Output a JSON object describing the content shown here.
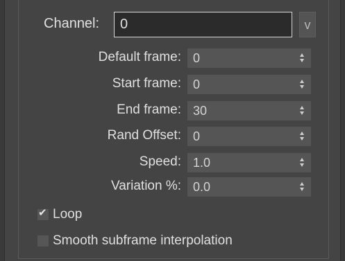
{
  "channel": {
    "label": "Channel:",
    "value": "0",
    "button_label": "v"
  },
  "fields": [
    {
      "label": "Default frame:",
      "value": "0"
    },
    {
      "label": "Start frame:",
      "value": "0"
    },
    {
      "label": "End frame:",
      "value": "30"
    },
    {
      "label": "Rand Offset:",
      "value": "0"
    },
    {
      "label": "Speed:",
      "value": "1.0"
    },
    {
      "label": "Variation %:",
      "value": "0.0"
    }
  ],
  "checkboxes": [
    {
      "label": "Loop",
      "checked": true,
      "mark": "✔"
    },
    {
      "label": "Smooth subframe interpolation",
      "checked": false,
      "mark": ""
    }
  ],
  "colors": {
    "background": "#444444",
    "field_background": "#555555",
    "input_background": "#2b2b2b",
    "text": "#e0e0e0"
  }
}
